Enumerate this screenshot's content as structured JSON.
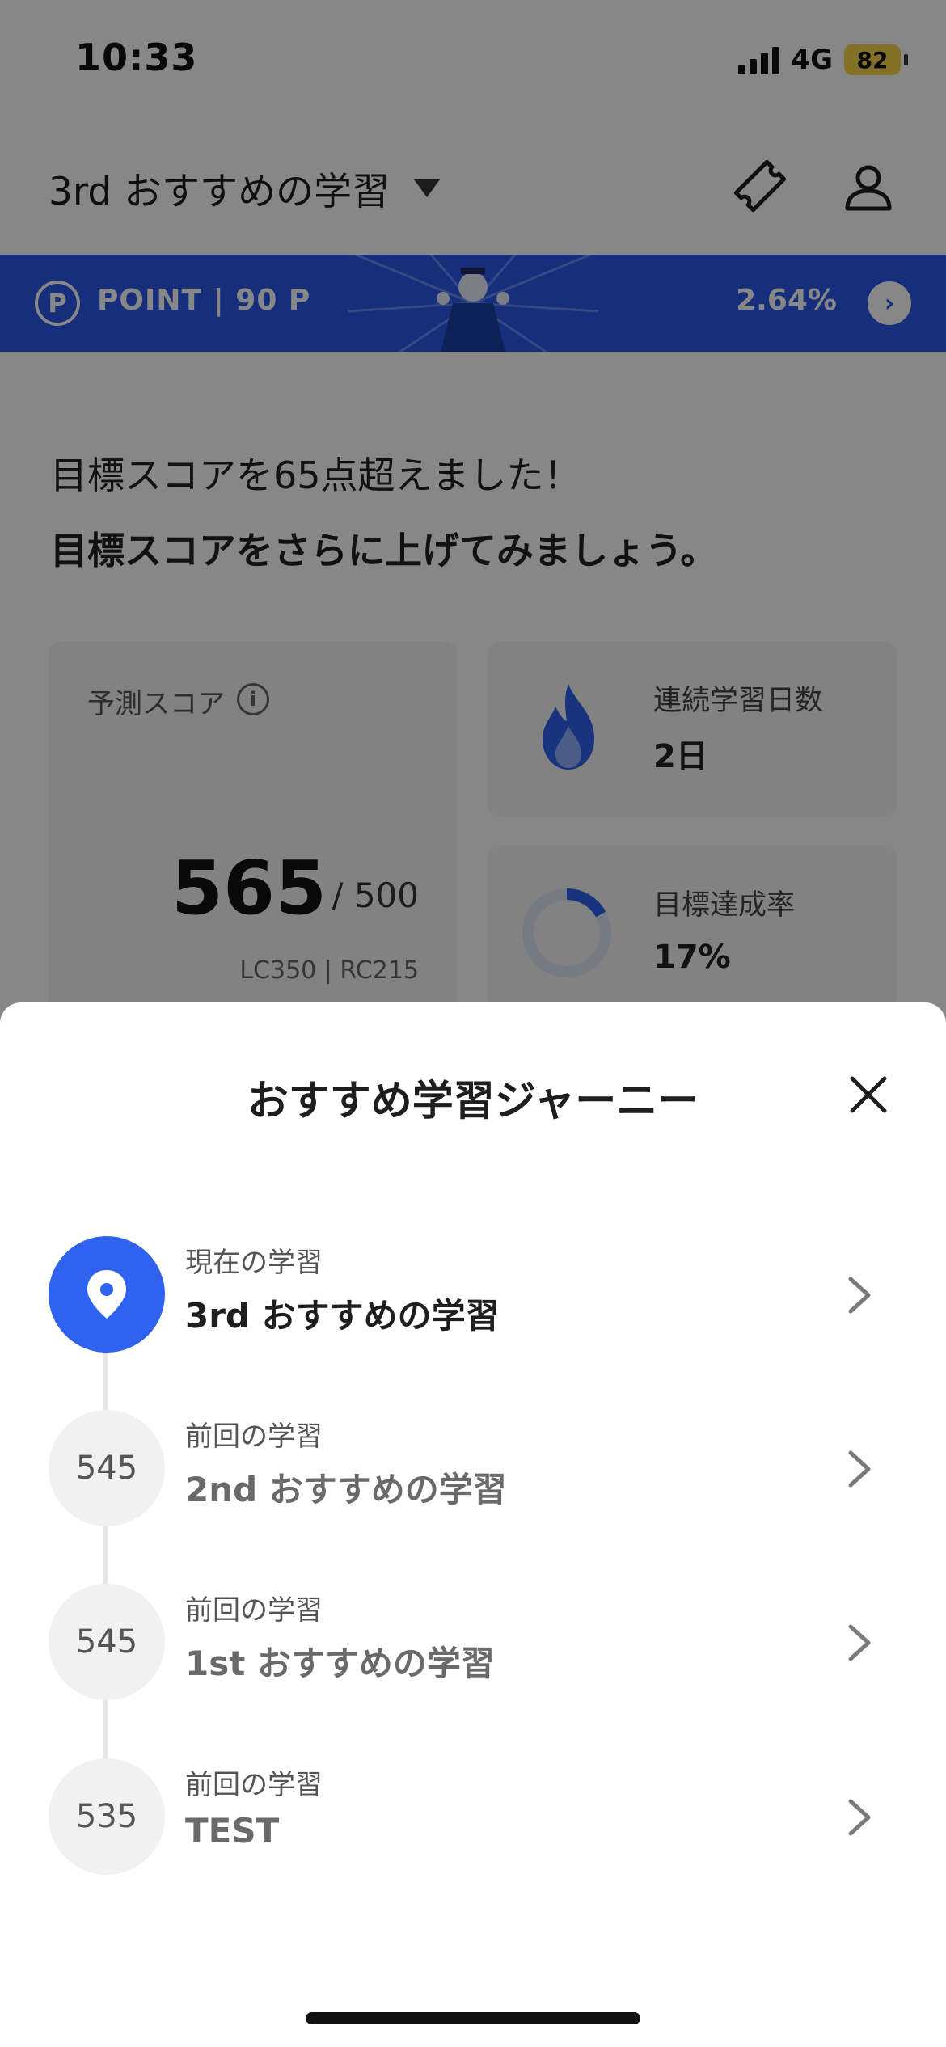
{
  "status_bar": {
    "time": "10:33",
    "network": "4G",
    "battery": "82"
  },
  "header": {
    "title": "3rd おすすめの学習"
  },
  "point_banner": {
    "icon_letter": "P",
    "label": "POINT | 90 P",
    "rate": "2.64%",
    "arrow": "›"
  },
  "notice": {
    "line1": "目標スコアを65点超えました！",
    "line2": "目標スコアをさらに上げてみましょう。"
  },
  "score_card": {
    "label": "予測スコア",
    "info": "i",
    "score": "565",
    "target": "/ 500",
    "breakdown": "LC350 | RC215"
  },
  "streak_card": {
    "label": "連続学習日数",
    "value": "2日"
  },
  "goal_card": {
    "label": "目標達成率",
    "value": "17%",
    "progress": 0.17
  },
  "sheet": {
    "title": "おすすめ学習ジャーニー",
    "steps": [
      {
        "subtitle": "現在の学習",
        "title": "3rd おすすめの学習",
        "badge": ""
      },
      {
        "subtitle": "前回の学習",
        "title": "2nd おすすめの学習",
        "badge": "545"
      },
      {
        "subtitle": "前回の学習",
        "title": "1st おすすめの学習",
        "badge": "545"
      },
      {
        "subtitle": "前回の学習",
        "title": "TEST",
        "badge": "535"
      }
    ]
  },
  "colors": {
    "accent": "#2f62ef",
    "banner": "#2a58e8",
    "battery": "#f7d64a"
  }
}
